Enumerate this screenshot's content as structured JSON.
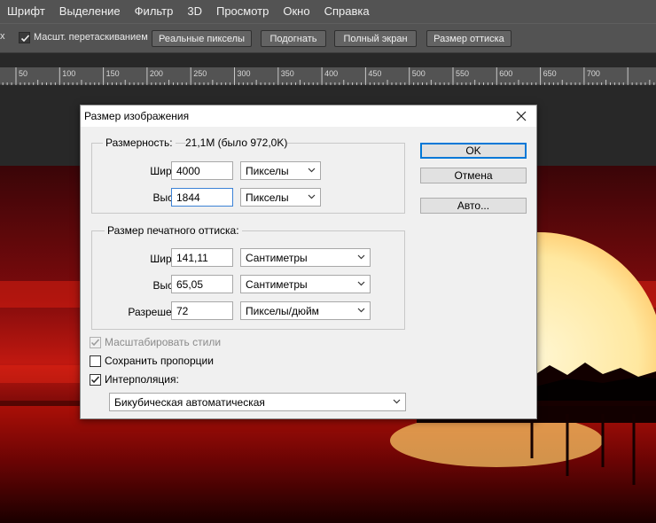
{
  "menu": [
    "Шрифт",
    "Выделение",
    "Фильтр",
    "3D",
    "Просмотр",
    "Окно",
    "Справка"
  ],
  "options": {
    "partial_char": "x",
    "drag_zoom_label": "Масшт. перетаскиванием",
    "drag_zoom_checked": true,
    "buttons": [
      "Реальные пикселы",
      "Подогнать",
      "Полный экран",
      "Размер оттиска"
    ]
  },
  "ruler": {
    "ticks": [
      "50",
      "100",
      "150",
      "200",
      "250",
      "300",
      "350",
      "400",
      "450",
      "500",
      "550",
      "600",
      "650",
      "700"
    ]
  },
  "dialog": {
    "title": "Размер изображения",
    "pixel_dimensions": {
      "label": "Размерность:",
      "value": "21,1M (было 972,0K)",
      "width_label": "Ширина:",
      "width_value": "4000",
      "width_unit": "Пикселы",
      "height_label": "Высота:",
      "height_value": "1844",
      "height_unit": "Пикселы"
    },
    "document_size": {
      "label": "Размер печатного оттиска:",
      "width_label": "Ширина:",
      "width_value": "141,11",
      "width_unit": "Сантиметры",
      "height_label": "Высота:",
      "height_value": "65,05",
      "height_unit": "Сантиметры",
      "resolution_label": "Разрешение:",
      "resolution_value": "72",
      "resolution_unit": "Пикселы/дюйм"
    },
    "checkboxes": {
      "scale_styles": "Масштабировать стили",
      "scale_styles_checked": true,
      "scale_styles_enabled": false,
      "constrain": "Сохранить пропорции",
      "constrain_checked": false,
      "resample": "Интерполяция:",
      "resample_checked": true
    },
    "resample_method": "Бикубическая автоматическая",
    "buttons": {
      "ok": "OK",
      "cancel": "Отмена",
      "auto": "Авто..."
    }
  }
}
